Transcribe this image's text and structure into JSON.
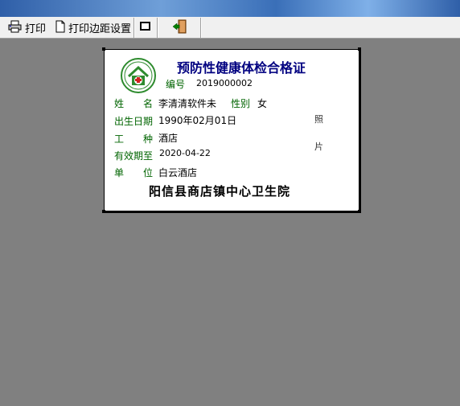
{
  "toolbar": {
    "print_label": "打印",
    "margin_label": "打印边距设置"
  },
  "card": {
    "title": "预防性健康体检合格证",
    "number_label": "编号",
    "number_value": "2019000002",
    "name_label": "姓　　名",
    "name_value": "李清清软件未",
    "gender_label": "性别",
    "gender_value": "女",
    "birth_label": "出生日期",
    "birth_value": "1990年02月01日",
    "job_label": "工　　种",
    "job_value": "酒店",
    "valid_label": "有效期至",
    "valid_value": "2020-04-22",
    "unit_label": "单　　位",
    "unit_value": "白云酒店",
    "photo_top": "照",
    "photo_bottom": "片",
    "issuer": "阳信县商店镇中心卫生院"
  },
  "colors": {
    "label_green": "#006400",
    "title_navy": "#000080",
    "workspace_gray": "#808080"
  }
}
